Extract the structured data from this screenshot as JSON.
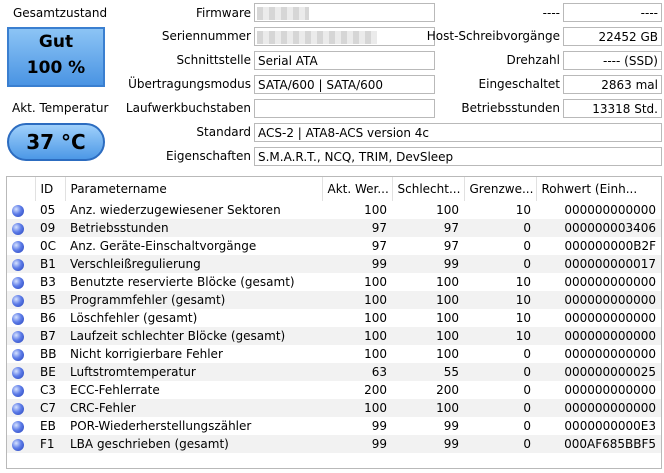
{
  "left": {
    "health_title": "Gesamtzustand",
    "health_status": "Gut",
    "health_percent": "100 %",
    "temp_title": "Akt. Temperatur",
    "temp_value": "37 °C"
  },
  "info": {
    "firmware_label": "Firmware",
    "serial_label": "Seriennummer",
    "interface_label": "Schnittstelle",
    "interface_value": "Serial ATA",
    "transfer_label": "Übertragungsmodus",
    "transfer_value": "SATA/600 | SATA/600",
    "drive_letters_label": "Laufwerkbuchstaben",
    "drive_letters_value": "",
    "standard_label": "Standard",
    "standard_value": "ACS-2 | ATA8-ACS version 4c",
    "features_label": "Eigenschaften",
    "features_value": "S.M.A.R.T., NCQ, TRIM, DevSleep"
  },
  "right_info": {
    "top_left_label": "----",
    "top_right_value": "----",
    "host_writes_label": "Host-Schreibvorgänge",
    "host_writes_value": "22452 GB",
    "rotation_label": "Drehzahl",
    "rotation_value": "---- (SSD)",
    "power_on_count_label": "Eingeschaltet",
    "power_on_count_value": "2863 mal",
    "power_on_hours_label": "Betriebsstunden",
    "power_on_hours_value": "13318 Std."
  },
  "table": {
    "headers": [
      "",
      "ID",
      "Parametername",
      "Akt. Wer...",
      "Schlecht...",
      "Grenzwe...",
      "Rohwert (Einh..."
    ],
    "rows": [
      [
        "05",
        "Anz. wiederzugewiesener Sektoren",
        "100",
        "100",
        "10",
        "000000000000"
      ],
      [
        "09",
        "Betriebsstunden",
        "97",
        "97",
        "0",
        "000000003406"
      ],
      [
        "0C",
        "Anz. Geräte-Einschaltvorgänge",
        "97",
        "97",
        "0",
        "000000000B2F"
      ],
      [
        "B1",
        "Verschleißregulierung",
        "99",
        "99",
        "0",
        "000000000017"
      ],
      [
        "B3",
        "Benutzte reservierte Blöcke (gesamt)",
        "100",
        "100",
        "10",
        "000000000000"
      ],
      [
        "B5",
        "Programmfehler (gesamt)",
        "100",
        "100",
        "10",
        "000000000000"
      ],
      [
        "B6",
        "Löschfehler (gesamt)",
        "100",
        "100",
        "10",
        "000000000000"
      ],
      [
        "B7",
        "Laufzeit schlechter Blöcke (gesamt)",
        "100",
        "100",
        "10",
        "000000000000"
      ],
      [
        "BB",
        "Nicht korrigierbare Fehler",
        "100",
        "100",
        "0",
        "000000000000"
      ],
      [
        "BE",
        "Luftstromtemperatur",
        "63",
        "55",
        "0",
        "000000000025"
      ],
      [
        "C3",
        "ECC-Fehlerrate",
        "200",
        "200",
        "0",
        "000000000000"
      ],
      [
        "C7",
        "CRC-Fehler",
        "100",
        "100",
        "0",
        "000000000000"
      ],
      [
        "EB",
        "POR-Wiederherstellungszähler",
        "99",
        "99",
        "0",
        "0000000000E3"
      ],
      [
        "F1",
        "LBA geschrieben (gesamt)",
        "99",
        "99",
        "0",
        "000AF685BBF5"
      ]
    ]
  },
  "colors": {
    "status_blue": "#4a94e3",
    "dot_blue": "#5d7ce8"
  }
}
